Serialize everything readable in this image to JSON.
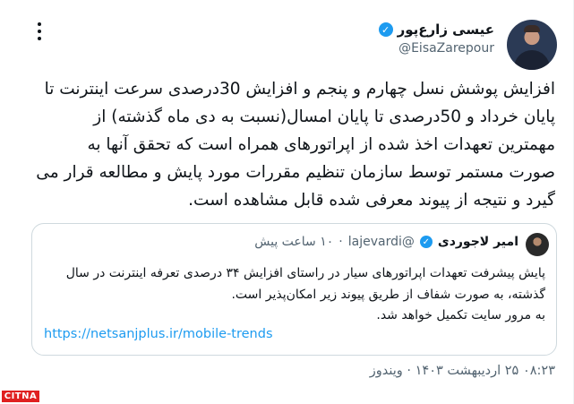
{
  "author": {
    "name": "عیسی زارع‌پور",
    "handle": "@EisaZarepour",
    "verified_glyph": "✓"
  },
  "tweet": {
    "lines": [
      "افزایش پوشش نسل چهارم و پنجم و افزایش 30درصدی سرعت اینترنت تا",
      "پایان خرداد و 50درصدی تا پایان امسال(نسبت به دی ماه گذشته) از",
      "مهمترین تعهدات اخذ شده از اپراتورهای همراه است که تحقق آنها به",
      "صورت مستمر توسط سازمان تنظیم مقررات مورد پایش و مطالعه قرار می",
      "گیرد و نتیجه از پیوند معرفی شده قابل مشاهده است."
    ]
  },
  "quote": {
    "name": "امیر لاجوردی",
    "handle": "@lajevardi",
    "dot": "·",
    "time": "۱۰ ساعت پیش",
    "verified_glyph": "✓",
    "lines": [
      "پایش پیشرفت تعهدات اپراتورهای سیار در راستای افزایش ۳۴ درصدی تعرفه اینترنت در سال",
      "گذشته، به صورت شفاف از طریق پیوند زیر امکان‌پذیر است.",
      "به مرور سایت تکمیل خواهد شد."
    ],
    "link": "https://netsanjplus.ir/mobile-trends"
  },
  "meta": {
    "timestamp": "۰۸:۲۳ ۲۵ اردیبهشت ۱۴۰۳ · ویندوز"
  },
  "watermark": {
    "text": "CITNA"
  },
  "colors": {
    "accent": "#1d9bf0",
    "secondary_text": "#536471",
    "border": "#cfd9de",
    "watermark": "#e02020"
  }
}
